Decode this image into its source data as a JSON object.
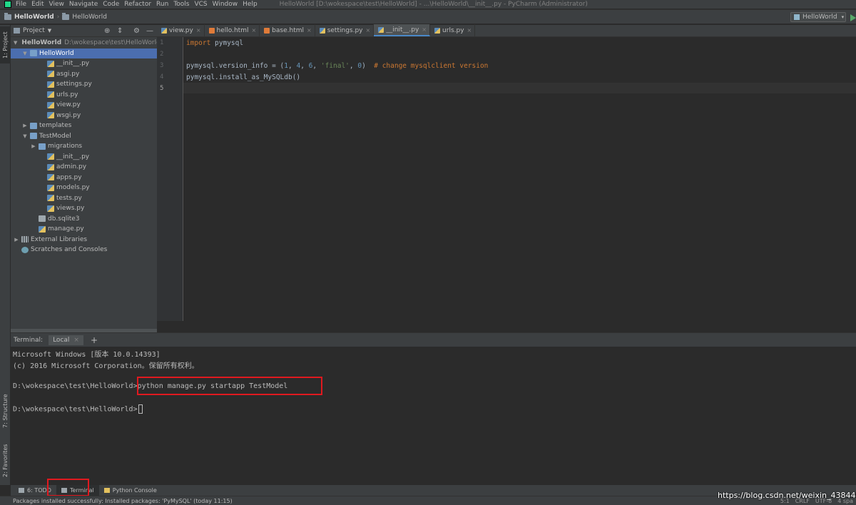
{
  "menubar": {
    "items": [
      "File",
      "Edit",
      "View",
      "Navigate",
      "Code",
      "Refactor",
      "Run",
      "Tools",
      "VCS",
      "Window",
      "Help"
    ],
    "window_title": "HelloWorld [D:\\wokespace\\test\\HelloWorld] - ...\\HelloWorld\\__init__.py - PyCharm (Administrator)"
  },
  "navbar": {
    "crumbs": [
      "HelloWorld",
      "HelloWorld"
    ],
    "run_config": "HelloWorld"
  },
  "left_stripe": {
    "project": "1: Project",
    "structure": "7: Structure",
    "favorites": "2: Favorites"
  },
  "project_panel": {
    "title": "Project",
    "tree": [
      {
        "label": "HelloWorld",
        "path": "D:\\wokespace\\test\\HelloWorld",
        "type": "root",
        "depth": 0,
        "arrow": "down"
      },
      {
        "label": "HelloWorld",
        "type": "folder",
        "depth": 1,
        "arrow": "down",
        "selected": true
      },
      {
        "label": "__init__.py",
        "type": "py",
        "depth": 3
      },
      {
        "label": "asgi.py",
        "type": "py",
        "depth": 3
      },
      {
        "label": "settings.py",
        "type": "py",
        "depth": 3
      },
      {
        "label": "urls.py",
        "type": "py",
        "depth": 3
      },
      {
        "label": "view.py",
        "type": "py",
        "depth": 3
      },
      {
        "label": "wsgi.py",
        "type": "py",
        "depth": 3
      },
      {
        "label": "templates",
        "type": "folder",
        "depth": 1,
        "arrow": "right"
      },
      {
        "label": "TestModel",
        "type": "folder",
        "depth": 1,
        "arrow": "down"
      },
      {
        "label": "migrations",
        "type": "folder",
        "depth": 2,
        "arrow": "right"
      },
      {
        "label": "__init__.py",
        "type": "py",
        "depth": 3
      },
      {
        "label": "admin.py",
        "type": "py",
        "depth": 3
      },
      {
        "label": "apps.py",
        "type": "py",
        "depth": 3
      },
      {
        "label": "models.py",
        "type": "py",
        "depth": 3
      },
      {
        "label": "tests.py",
        "type": "py",
        "depth": 3
      },
      {
        "label": "views.py",
        "type": "py",
        "depth": 3
      },
      {
        "label": "db.sqlite3",
        "type": "db",
        "depth": 2
      },
      {
        "label": "manage.py",
        "type": "py",
        "depth": 2
      },
      {
        "label": "External Libraries",
        "type": "lib",
        "depth": 0,
        "arrow": "right"
      },
      {
        "label": "Scratches and Consoles",
        "type": "scratch",
        "depth": 0
      }
    ]
  },
  "editor": {
    "tabs": [
      {
        "label": "view.py",
        "type": "py"
      },
      {
        "label": "hello.html",
        "type": "html"
      },
      {
        "label": "base.html",
        "type": "html"
      },
      {
        "label": "settings.py",
        "type": "py"
      },
      {
        "label": "__init__.py",
        "type": "py",
        "active": true
      },
      {
        "label": "urls.py",
        "type": "py"
      }
    ],
    "line_numbers": [
      "1",
      "2",
      "3",
      "4",
      "5"
    ],
    "code": {
      "l1_kw": "import",
      "l1_rest": " pymysql",
      "l3_a": "pymysql.version_info = (",
      "l3_n1": "1",
      "l3_c1": ", ",
      "l3_n2": "4",
      "l3_c2": ", ",
      "l3_n3": "6",
      "l3_c3": ", ",
      "l3_s": "'final'",
      "l3_c4": ", ",
      "l3_n4": "0",
      "l3_close": ")",
      "l3_comment": "  # change mysqlclient version",
      "l4": "pymysql.install_as_MySQLdb()"
    }
  },
  "terminal": {
    "title": "Terminal:",
    "tab": "Local",
    "lines": [
      "Microsoft Windows [版本 10.0.14393]",
      "(c) 2016 Microsoft Corporation。保留所有权利。",
      "D:\\wokespace\\test\\HelloWorld>python manage.py startapp TestModel",
      "D:\\wokespace\\test\\HelloWorld>"
    ]
  },
  "bottom_tabs": {
    "todo": "6: TODO",
    "terminal": "Terminal",
    "python_console": "Python Console"
  },
  "status": {
    "message": "Packages installed successfully: Installed packages: 'PyMySQL' (today 11:15)",
    "position": "5:1",
    "line_sep": "CRLF",
    "encoding": "UTF-8",
    "indent": "4 spa"
  },
  "watermark": "https://blog.csdn.net/weixin_43844071",
  "colors": {
    "selection": "#4b6eaf",
    "highlight_box": "#e0191f",
    "keyword": "#cc7832",
    "number": "#6897bb",
    "string": "#6a8759"
  }
}
